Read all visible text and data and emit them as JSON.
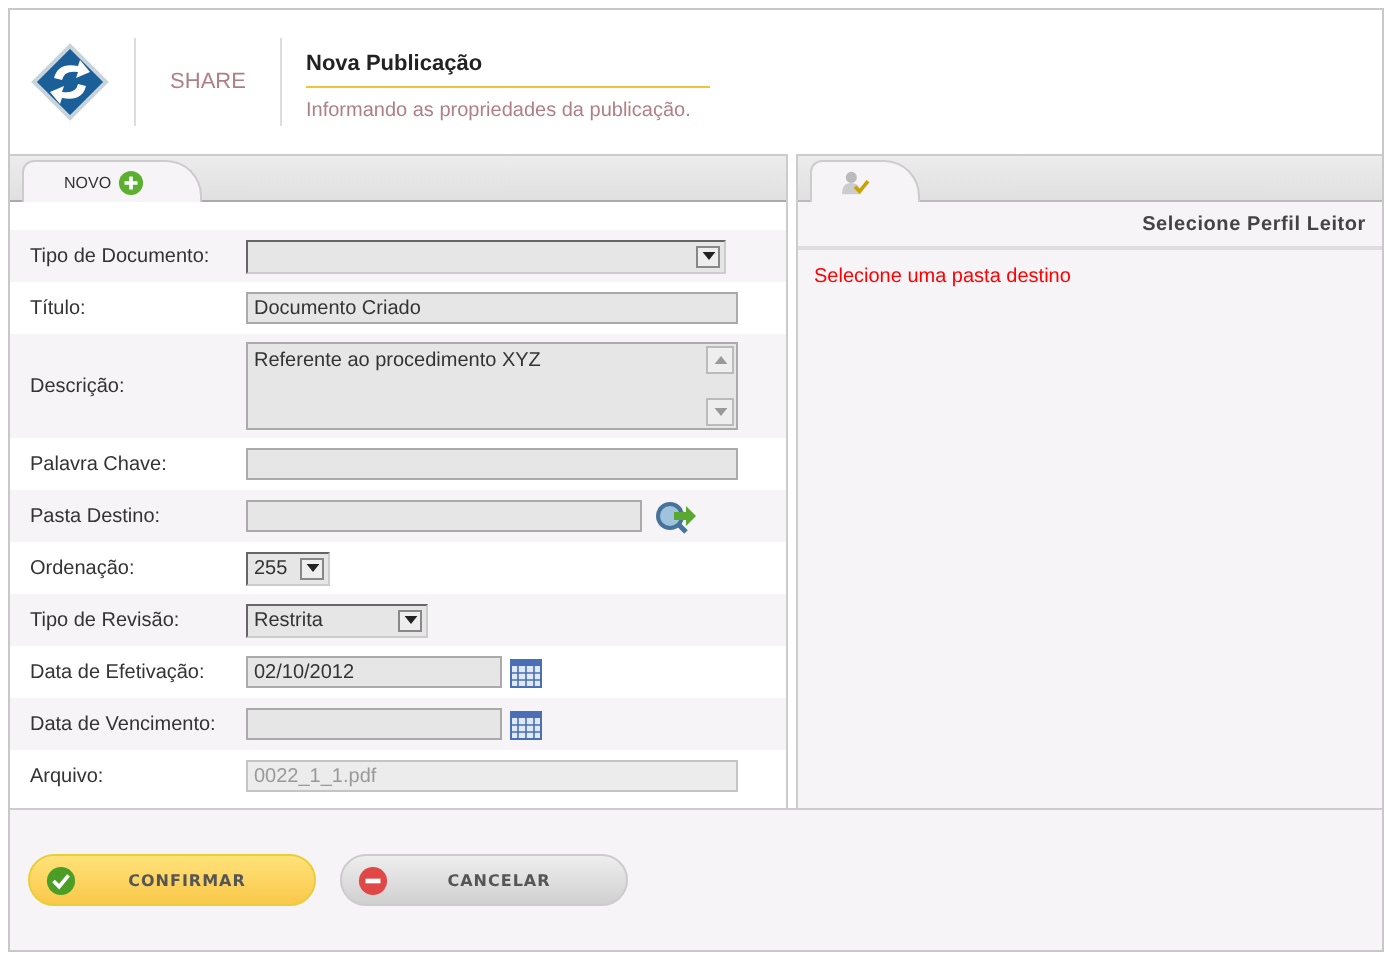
{
  "header": {
    "brand": "SHARE",
    "title": "Nova Publicação",
    "subtitle": "Informando as propriedades da publicação."
  },
  "form_tab": {
    "label": "NOVO"
  },
  "fields": [
    {
      "label": "Tipo de Documento:",
      "kind": "dropdown",
      "disabled": false
    },
    {
      "label": "Título:",
      "kind": "text",
      "value": "Documento Criado",
      "disabled": false
    },
    {
      "label": "Descrição:",
      "kind": "textarea",
      "value": "Referente ao procedimento XYZ",
      "disabled": false
    },
    {
      "label": "Palavra Chave:",
      "kind": "text",
      "disabled": false
    },
    {
      "label": "Pasta Destino:",
      "kind": "folder",
      "disabled": false
    },
    {
      "label": "Ordenação:",
      "kind": "small-dropdown",
      "value": "255",
      "disabled": false
    },
    {
      "label": "Tipo de Revisão:",
      "kind": "medium-dropdown",
      "value": "Restrita",
      "disabled": false
    },
    {
      "label": "Data de Efetivação:",
      "kind": "date",
      "value": "02/10/2012",
      "disabled": false
    },
    {
      "label": "Data de Vencimento:",
      "kind": "date",
      "disabled": false
    },
    {
      "label": "Arquivo:",
      "kind": "text",
      "value": "0022_1_1.pdf",
      "disabled": true
    }
  ],
  "reader_panel": {
    "heading": "Selecione Perfil Leitor",
    "message": "Selecione uma pasta destino"
  },
  "buttons": [
    {
      "label": "CONFIRMAR",
      "kind": "confirm"
    },
    {
      "label": "CANCELAR",
      "kind": "cancel"
    }
  ]
}
